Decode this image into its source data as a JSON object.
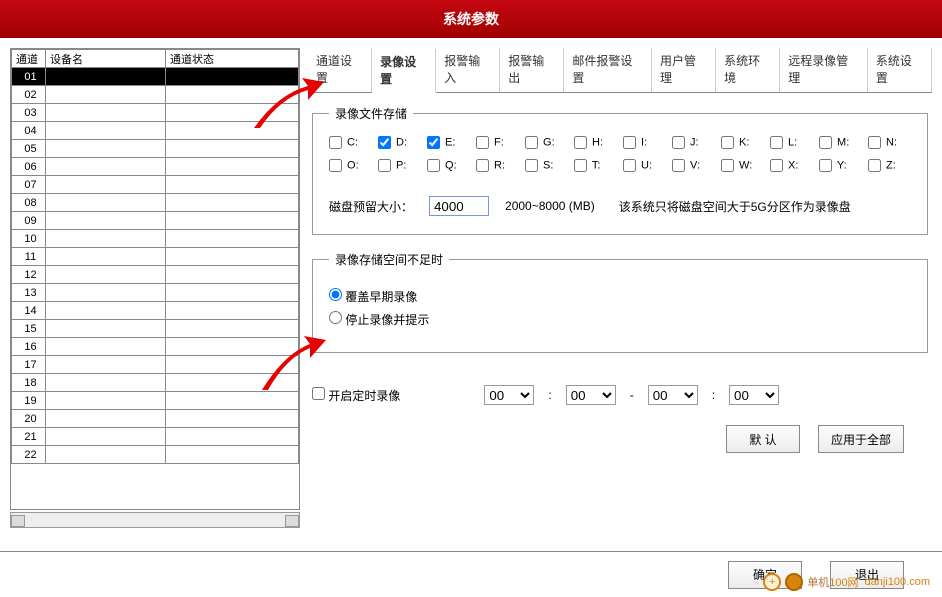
{
  "title": "系统参数",
  "table": {
    "headers": {
      "channel": "通道",
      "device": "设备名",
      "status": "通道状态"
    },
    "rows": [
      {
        "ch": "01",
        "sel": true
      },
      {
        "ch": "02"
      },
      {
        "ch": "03"
      },
      {
        "ch": "04"
      },
      {
        "ch": "05"
      },
      {
        "ch": "06"
      },
      {
        "ch": "07"
      },
      {
        "ch": "08"
      },
      {
        "ch": "09"
      },
      {
        "ch": "10"
      },
      {
        "ch": "11"
      },
      {
        "ch": "12"
      },
      {
        "ch": "13"
      },
      {
        "ch": "14"
      },
      {
        "ch": "15"
      },
      {
        "ch": "16"
      },
      {
        "ch": "17"
      },
      {
        "ch": "18"
      },
      {
        "ch": "19"
      },
      {
        "ch": "20"
      },
      {
        "ch": "21"
      },
      {
        "ch": "22"
      }
    ]
  },
  "tabs": [
    "通道设置",
    "录像设置",
    "报警输入",
    "报警输出",
    "邮件报警设置",
    "用户管理",
    "系统环境",
    "远程录像管理",
    "系统设置"
  ],
  "active_tab": 1,
  "storage": {
    "legend": "录像文件存储",
    "drives": [
      {
        "label": "C:",
        "checked": false
      },
      {
        "label": "D:",
        "checked": true
      },
      {
        "label": "E:",
        "checked": true
      },
      {
        "label": "F:",
        "checked": false
      },
      {
        "label": "G:",
        "checked": false
      },
      {
        "label": "H:",
        "checked": false
      },
      {
        "label": "I:",
        "checked": false
      },
      {
        "label": "J:",
        "checked": false
      },
      {
        "label": "K:",
        "checked": false
      },
      {
        "label": "L:",
        "checked": false
      },
      {
        "label": "M:",
        "checked": false
      },
      {
        "label": "N:",
        "checked": false
      },
      {
        "label": "O:",
        "checked": false
      },
      {
        "label": "P:",
        "checked": false
      },
      {
        "label": "Q:",
        "checked": false
      },
      {
        "label": "R:",
        "checked": false
      },
      {
        "label": "S:",
        "checked": false
      },
      {
        "label": "T:",
        "checked": false
      },
      {
        "label": "U:",
        "checked": false
      },
      {
        "label": "V:",
        "checked": false
      },
      {
        "label": "W:",
        "checked": false
      },
      {
        "label": "X:",
        "checked": false
      },
      {
        "label": "Y:",
        "checked": false
      },
      {
        "label": "Z:",
        "checked": false
      }
    ],
    "reserve_label": "磁盘预留大小：",
    "reserve_value": "4000",
    "reserve_range": "2000~8000 (MB)",
    "reserve_note": "该系统只将磁盘空间大于5G分区作为录像盘"
  },
  "when_full": {
    "legend": "录像存储空间不足时",
    "opt_overwrite": "覆盖早期录像",
    "opt_stop": "停止录像并提示",
    "selected": "overwrite"
  },
  "timer": {
    "enable_label": "开启定时录像",
    "enabled": false,
    "h1": "00",
    "m1": "00",
    "h2": "00",
    "m2": "00",
    "colon": ":",
    "dash": "-"
  },
  "buttons": {
    "default": "默 认",
    "apply_all": "应用于全部",
    "ok": "确定",
    "exit": "退出"
  },
  "watermark": {
    "a": "单机",
    "b": "100网",
    "c": "danji100.com"
  }
}
